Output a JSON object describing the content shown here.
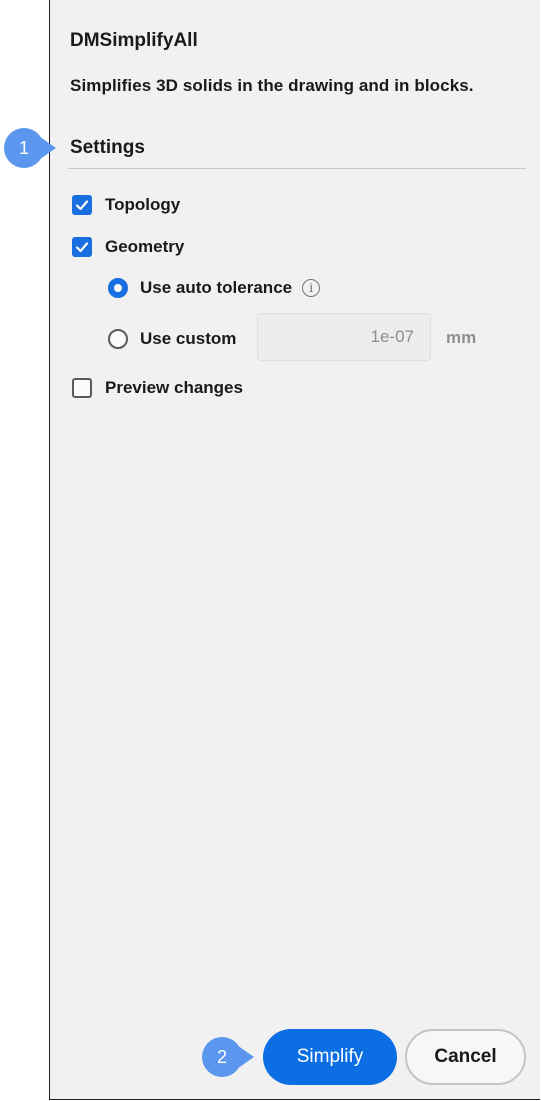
{
  "dialog": {
    "title": "DMSimplifyAll",
    "description": "Simplifies 3D solids in the drawing and in blocks."
  },
  "settings": {
    "heading": "Settings",
    "topology": {
      "label": "Topology",
      "checked": true
    },
    "geometry": {
      "label": "Geometry",
      "checked": true
    },
    "auto_tolerance": {
      "label": "Use auto tolerance",
      "selected": true
    },
    "custom_tolerance": {
      "label": "Use custom",
      "selected": false,
      "value": "1e-07",
      "unit": "mm"
    },
    "preview": {
      "label": "Preview changes",
      "checked": false
    }
  },
  "buttons": {
    "simplify": "Simplify",
    "cancel": "Cancel"
  },
  "callouts": {
    "settings_marker": "1",
    "simplify_marker": "2"
  },
  "colors": {
    "accent": "#0b6ee4",
    "callout": "#5b97ee",
    "panel_bg": "#f1f1f1"
  }
}
